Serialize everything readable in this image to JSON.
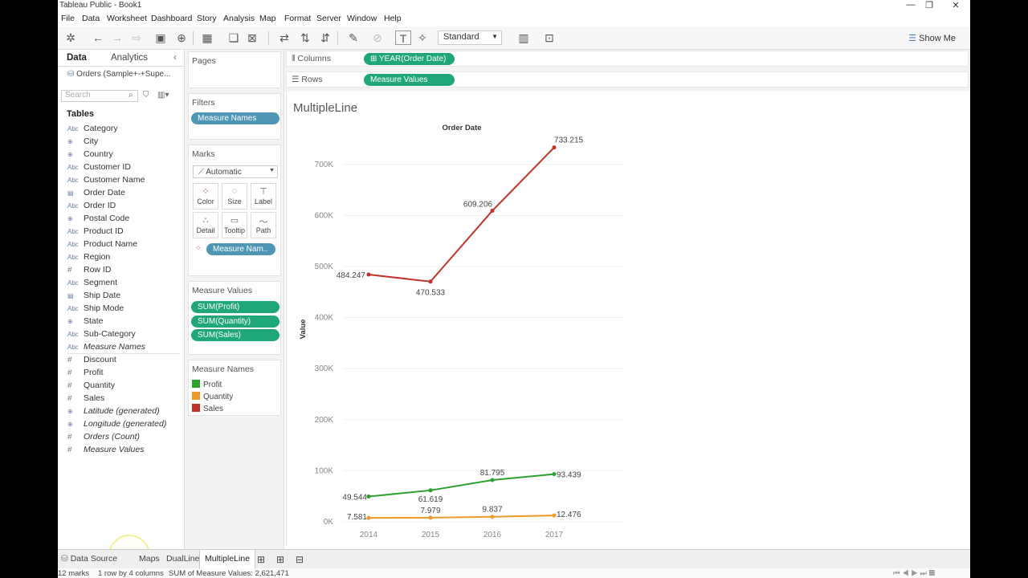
{
  "window": {
    "title": "Tableau Public - Book1",
    "minimize": "—",
    "restore": "❐",
    "close": "✕"
  },
  "menu": [
    "File",
    "Data",
    "Worksheet",
    "Dashboard",
    "Story",
    "Analysis",
    "Map",
    "Format",
    "Server",
    "Window",
    "Help"
  ],
  "toolbar": {
    "fit_select": "Standard",
    "show_me": "Show Me"
  },
  "left": {
    "tab_data": "Data",
    "tab_analytics": "Analytics",
    "datasource": "Orders (Sample+-+Supe...",
    "search_placeholder": "Search",
    "tables_heading": "Tables",
    "fields": [
      {
        "icon": "Abc",
        "name": "Category"
      },
      {
        "icon": "globe",
        "name": "City"
      },
      {
        "icon": "globe",
        "name": "Country"
      },
      {
        "icon": "Abc",
        "name": "Customer ID"
      },
      {
        "icon": "Abc",
        "name": "Customer Name"
      },
      {
        "icon": "date",
        "name": "Order Date"
      },
      {
        "icon": "Abc",
        "name": "Order ID"
      },
      {
        "icon": "globe",
        "name": "Postal Code"
      },
      {
        "icon": "Abc",
        "name": "Product ID"
      },
      {
        "icon": "Abc",
        "name": "Product Name"
      },
      {
        "icon": "Abc",
        "name": "Region"
      },
      {
        "icon": "#",
        "name": "Row ID"
      },
      {
        "icon": "Abc",
        "name": "Segment"
      },
      {
        "icon": "date",
        "name": "Ship Date"
      },
      {
        "icon": "Abc",
        "name": "Ship Mode"
      },
      {
        "icon": "globe",
        "name": "State"
      },
      {
        "icon": "Abc",
        "name": "Sub-Category"
      },
      {
        "icon": "Abc",
        "name": "Measure Names",
        "italic": true
      }
    ],
    "measures": [
      {
        "icon": "#",
        "name": "Discount"
      },
      {
        "icon": "#",
        "name": "Profit"
      },
      {
        "icon": "#",
        "name": "Quantity"
      },
      {
        "icon": "#",
        "name": "Sales"
      },
      {
        "icon": "globe",
        "name": "Latitude (generated)",
        "italic": true
      },
      {
        "icon": "globe",
        "name": "Longitude (generated)",
        "italic": true
      },
      {
        "icon": "#",
        "name": "Orders (Count)",
        "italic": true
      },
      {
        "icon": "#",
        "name": "Measure Values",
        "italic": true
      }
    ]
  },
  "cards": {
    "pages": "Pages",
    "filters": "Filters",
    "filter_pill": "Measure Names",
    "marks": "Marks",
    "mark_type": "Automatic",
    "mark_buttons": [
      "Color",
      "Size",
      "Label",
      "Detail",
      "Tooltip",
      "Path"
    ],
    "marks_pill": "Measure Nam..",
    "measure_values": "Measure Values",
    "mv_pills": [
      "SUM(Profit)",
      "SUM(Quantity)",
      "SUM(Sales)"
    ],
    "legend_title": "Measure Names",
    "legend": [
      {
        "name": "Profit",
        "color": "#2ca02c"
      },
      {
        "name": "Quantity",
        "color": "#ed9a2d"
      },
      {
        "name": "Sales",
        "color": "#c0332b"
      }
    ]
  },
  "shelves": {
    "columns_label": "Columns",
    "columns_pill": "YEAR(Order Date)",
    "rows_label": "Rows",
    "rows_pill": "Measure Values"
  },
  "sheet": {
    "title": "MultipleLine"
  },
  "chart_data": {
    "type": "line",
    "title": "Order Date",
    "xlabel": "Order Date",
    "ylabel": "Value",
    "x": [
      "2014",
      "2015",
      "2016",
      "2017"
    ],
    "ylim": [
      0,
      750000
    ],
    "yticks": [
      "0K",
      "100K",
      "200K",
      "300K",
      "400K",
      "500K",
      "600K",
      "700K"
    ],
    "series": [
      {
        "name": "Sales",
        "color": "#c0332b",
        "values": [
          484247,
          470533,
          609206,
          733215
        ],
        "labels": [
          "484.247",
          "470.533",
          "609.206",
          "733.215"
        ]
      },
      {
        "name": "Profit",
        "color": "#2ca02c",
        "values": [
          49544,
          61619,
          81795,
          93439
        ],
        "labels": [
          "49.544",
          "61.619",
          "81.795",
          "93.439"
        ]
      },
      {
        "name": "Quantity",
        "color": "#ed9a2d",
        "values": [
          7581,
          7979,
          9837,
          12476
        ],
        "labels": [
          "7.581",
          "7.979",
          "9.837",
          "12.476"
        ]
      }
    ]
  },
  "tabs": {
    "datasource": "Data Source",
    "sheets": [
      "Maps",
      "DualLine",
      "MultipleLine"
    ],
    "active": "MultipleLine"
  },
  "status": {
    "marks": "12 marks",
    "rows": "1 row by 4 columns",
    "sum": "SUM of Measure Values: 2,621,471"
  }
}
